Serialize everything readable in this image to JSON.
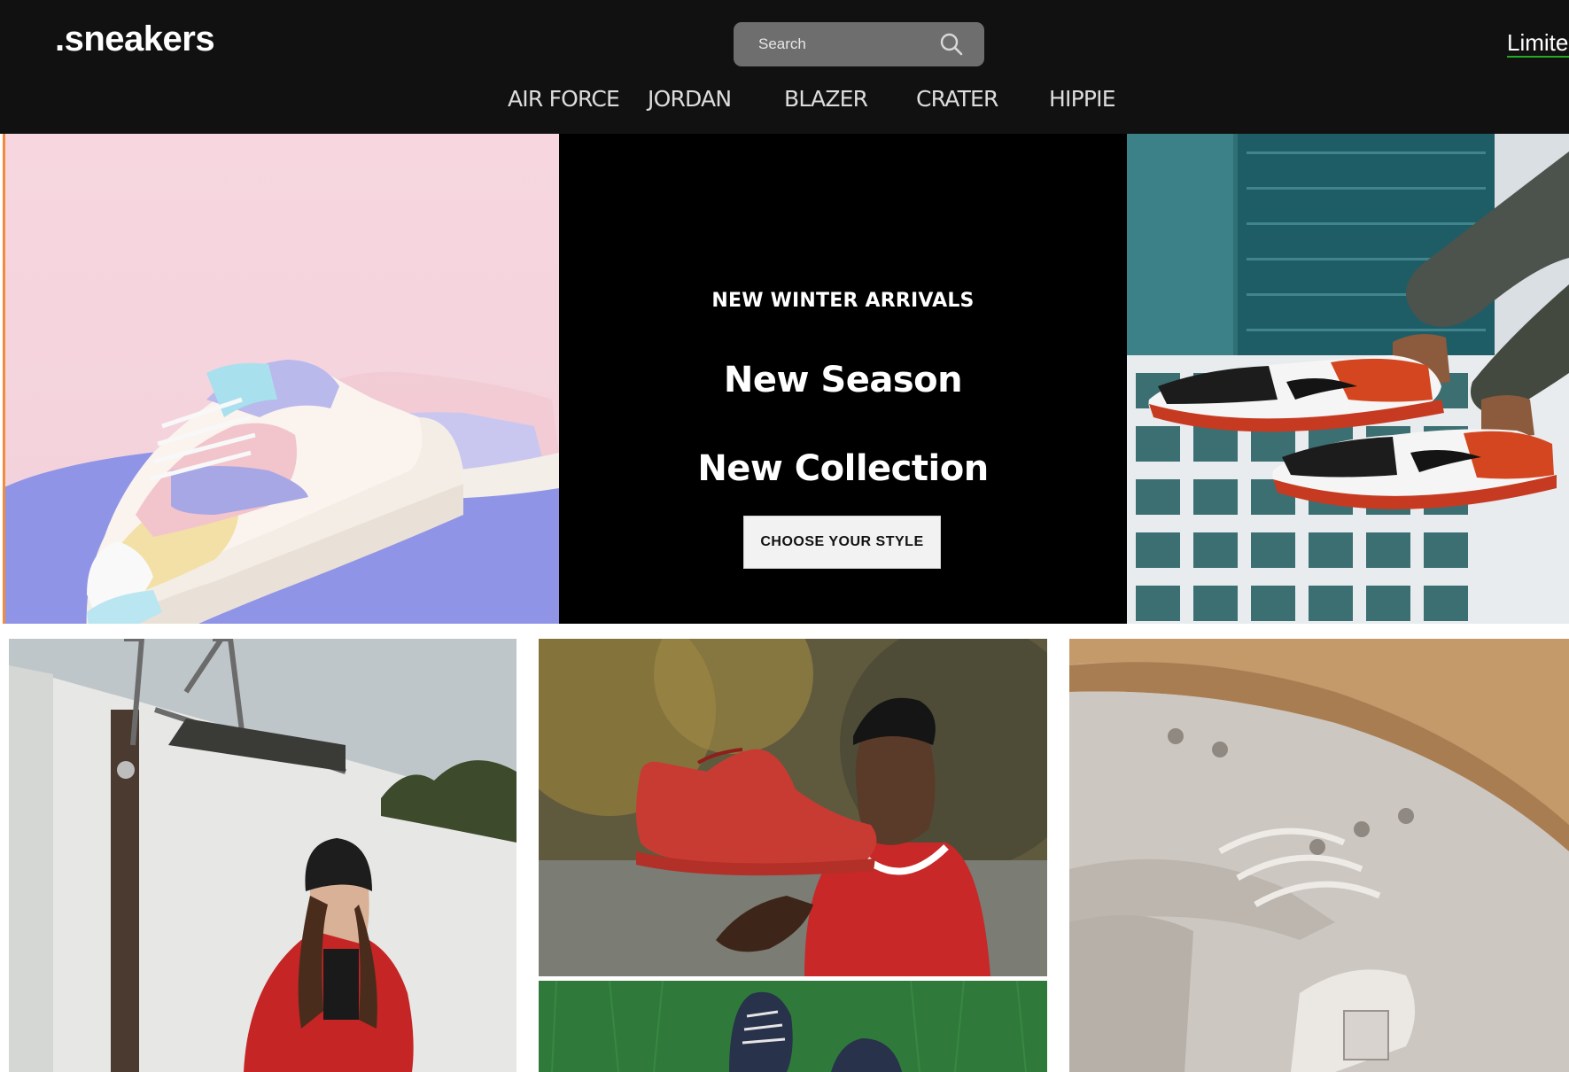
{
  "header": {
    "logo": ".sneakers",
    "search_placeholder": "Search",
    "limited_link": "Limited",
    "nav": [
      "AIR FORCE",
      "JORDAN",
      "BLAZER",
      "CRATER",
      "HIPPIE"
    ]
  },
  "hero": {
    "subheading": "NEW WINTER ARRIVALS",
    "heading_line1": "New Season",
    "heading_line2": "New Collection",
    "cta_label": "CHOOSE YOUR STYLE"
  },
  "colors": {
    "header_bg": "#111111",
    "hero_center_bg": "#000000",
    "accent_underline": "#22aa22",
    "cta_bg": "#f2f2f2"
  },
  "icons": {
    "search": "search-icon"
  }
}
